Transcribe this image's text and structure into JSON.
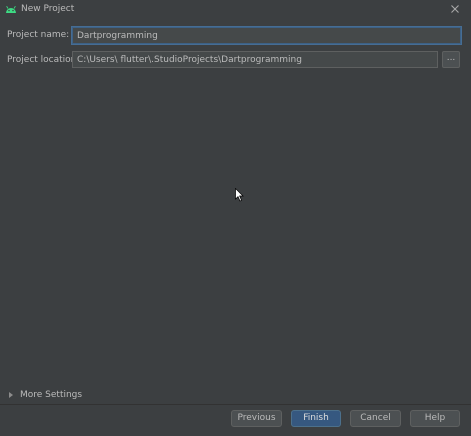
{
  "window": {
    "title": "New Project",
    "app_icon": "android-icon",
    "close_icon": "close-icon"
  },
  "form": {
    "project_name_label": "Project name:",
    "project_name_value": "Dartprogramming",
    "project_location_label": "Project location:",
    "project_location_value": "C:\\Users\\ flutter\\.StudioProjects\\Dartprogramming",
    "browse_label": "..."
  },
  "more_settings": {
    "label": "More Settings",
    "icon": "chevron-right-icon"
  },
  "buttons": {
    "previous": "Previous",
    "finish": "Finish",
    "cancel": "Cancel",
    "help": "Help"
  },
  "colors": {
    "background": "#3c3f41",
    "primary_button": "#365880",
    "focus_border": "#466d94",
    "android_green": "#3ddc84"
  }
}
